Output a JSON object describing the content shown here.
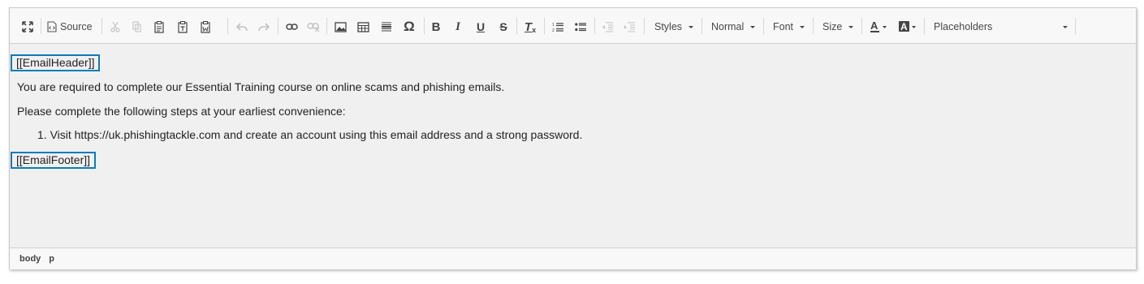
{
  "toolbar": {
    "buttons": [
      {
        "name": "maximize",
        "icon": "maximize-icon"
      },
      {
        "name": "source",
        "icon": "source-icon",
        "label": "Source"
      },
      {
        "name": "cut",
        "icon": "cut-icon",
        "disabled": true
      },
      {
        "name": "copy",
        "icon": "copy-icon",
        "disabled": true
      },
      {
        "name": "paste",
        "icon": "paste-icon"
      },
      {
        "name": "paste-text",
        "icon": "paste-text-icon"
      },
      {
        "name": "paste-word",
        "icon": "paste-word-icon"
      },
      {
        "name": "undo",
        "icon": "undo-icon",
        "disabled": true
      },
      {
        "name": "redo",
        "icon": "redo-icon",
        "disabled": true
      },
      {
        "name": "link",
        "icon": "link-icon"
      },
      {
        "name": "unlink",
        "icon": "unlink-icon",
        "disabled": true
      },
      {
        "name": "image",
        "icon": "image-icon"
      },
      {
        "name": "table",
        "icon": "table-icon"
      },
      {
        "name": "horizontal-rule",
        "icon": "horizontal-rule-icon"
      },
      {
        "name": "special-char",
        "icon": "omega-icon"
      },
      {
        "name": "bold",
        "icon": "bold-icon"
      },
      {
        "name": "italic",
        "icon": "italic-icon"
      },
      {
        "name": "underline",
        "icon": "underline-icon"
      },
      {
        "name": "strike",
        "icon": "strikethrough-icon"
      },
      {
        "name": "remove-format",
        "icon": "clear-format-icon"
      },
      {
        "name": "numbered-list",
        "icon": "numbered-list-icon"
      },
      {
        "name": "bulleted-list",
        "icon": "bulleted-list-icon"
      },
      {
        "name": "outdent",
        "icon": "outdent-icon",
        "disabled": true
      },
      {
        "name": "indent",
        "icon": "indent-icon",
        "disabled": true
      },
      {
        "name": "text-color",
        "icon": "text-color-icon"
      },
      {
        "name": "background-color",
        "icon": "background-color-icon"
      }
    ],
    "source_label": "Source",
    "styles_label": "Styles",
    "format_label": "Normal",
    "font_label": "Font",
    "size_label": "Size",
    "placeholders_label": "Placeholders"
  },
  "content": {
    "header_placeholder": "[[EmailHeader]]",
    "paragraph1": "You are required to complete our Essential Training course on online scams and phishing emails.",
    "paragraph2": "Please complete the following steps at your earliest convenience:",
    "steps": [
      "1. Visit https://uk.phishingtackle.com and create an account using this email address and a strong password."
    ],
    "footer_placeholder": "[[EmailFooter]]"
  },
  "statusbar": {
    "path": [
      "body",
      "p"
    ]
  },
  "colors": {
    "placeholder_border": "#0a7bbf",
    "content_bg": "#f0f0f0",
    "toolbar_bg": "#f8f8f8"
  }
}
